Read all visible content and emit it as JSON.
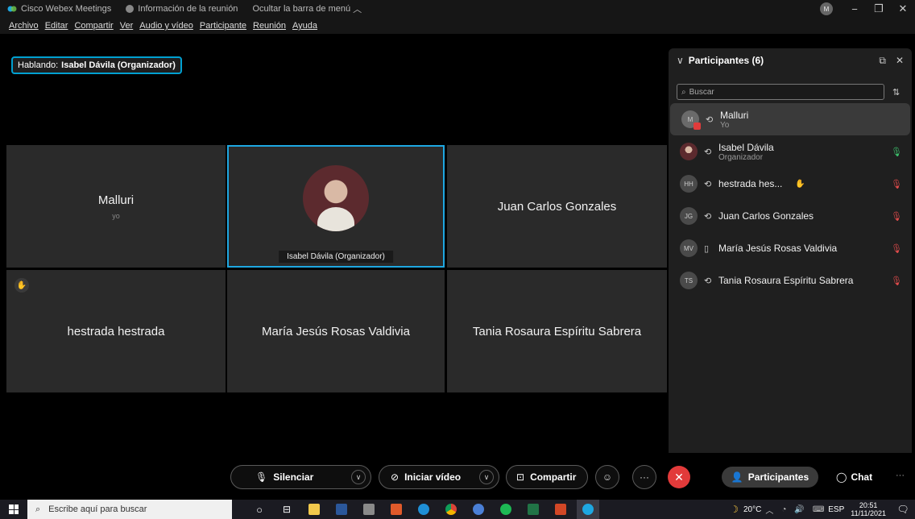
{
  "titlebar": {
    "app_name": "Cisco Webex Meetings",
    "meeting_info": "Información de la reunión",
    "hide_menu": "Ocultar la barra de menú",
    "avatar_initials": "M"
  },
  "menu": [
    "Archivo",
    "Editar",
    "Compartir",
    "Ver",
    "Audio y vídeo",
    "Participante",
    "Reunión",
    "Ayuda"
  ],
  "stage": {
    "speaking_label": "Hablando:",
    "speaking_name": "Isabel Dávila (Organizador)",
    "tiles": [
      {
        "name": "Malluri",
        "sub": "yo"
      },
      {
        "caption": "Isabel Dávila  (Organizador)"
      },
      {
        "name": "Juan Carlos Gonzales"
      },
      {
        "name": "hestrada hestrada"
      },
      {
        "name": "María Jesús Rosas Valdivia"
      },
      {
        "name": "Tania Rosaura Espíritu Sabrera"
      }
    ]
  },
  "panel": {
    "title": "Participantes (6)",
    "search_placeholder": "Buscar",
    "participants": [
      {
        "initials": "M",
        "name": "Malluri",
        "role": "Yo",
        "mic": "none"
      },
      {
        "initials": "",
        "name": "Isabel Dávila",
        "role": "Organizador",
        "mic": "on"
      },
      {
        "initials": "HH",
        "name": "hestrada hes...",
        "role": "",
        "mic": "off"
      },
      {
        "initials": "JG",
        "name": "Juan Carlos Gonzales",
        "role": "",
        "mic": "off"
      },
      {
        "initials": "MV",
        "name": "María Jesús Rosas Valdivia",
        "role": "",
        "mic": "off"
      },
      {
        "initials": "TS",
        "name": "Tania Rosaura Espíritu Sabrera",
        "role": "",
        "mic": "off"
      }
    ]
  },
  "controls": {
    "mute": "Silenciar",
    "video": "Iniciar vídeo",
    "share": "Compartir",
    "participants": "Participantes",
    "chat": "Chat"
  },
  "taskbar": {
    "search_placeholder": "Escribe aquí para buscar",
    "weather": "20°C",
    "language": "ESP",
    "time": "20:51",
    "date": "11/11/2021"
  },
  "colors": {
    "active_border": "#1ea7e1",
    "end_call": "#e23a3a",
    "mic_on": "#3cc06b",
    "mic_off": "#e04b4b"
  }
}
